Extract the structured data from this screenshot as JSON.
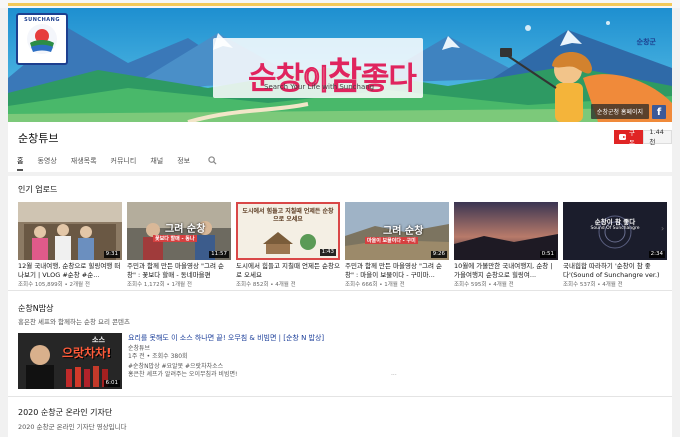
{
  "banner": {
    "logo_text": "SUNCHANG",
    "title_part1": "순창",
    "title_part2": "이",
    "title_part3": "참",
    "title_part4": "좋다",
    "subtitle": "Search Your Life with Sunchang",
    "brand": "순창군",
    "link_label": "순창군청 홈페이지",
    "fb_label": "f"
  },
  "channel": {
    "name": "순창튜브",
    "subscribe_label": "구독",
    "subscriber_count": "1.44천"
  },
  "tabs": [
    {
      "label": "홈",
      "active": true
    },
    {
      "label": "동영상"
    },
    {
      "label": "재생목록"
    },
    {
      "label": "커뮤니티"
    },
    {
      "label": "채널"
    },
    {
      "label": "정보"
    }
  ],
  "popular": {
    "title": "인기 업로드",
    "videos": [
      {
        "title": "12월 국내여행, 순창으로 힐링여행 떠나보기 | VLOG #순창 #순...",
        "meta": "조회수 105,899회 • 2개월 전",
        "duration": "9:31"
      },
      {
        "title": "주민과 함께 만든 마을영상 \"그려 순창\" : 꽃보다 할매 - 동네마을편",
        "meta": "조회수 1,172회 • 1개월 전",
        "duration": "11:57",
        "overlay": "그려 순창",
        "overlay_tag": "꽃보다 할매 - 동나"
      },
      {
        "title": "도시에서 힘들고 지칠때 언제든 순창으로 오세요",
        "meta": "조회수 852회 • 4개월 전",
        "duration": "1:43",
        "overlay": "도시에서 힘들고 지칠때 언제든 순창으로 오세요"
      },
      {
        "title": "주민과 함께 만든 마을영상 \"그려 순창\" : 마을이 보물이다 - 구미마...",
        "meta": "조회수 666회 • 1개월 전",
        "duration": "9:26",
        "overlay": "그려 순창",
        "overlay_tag": "마을이 보물이다 - 구미"
      },
      {
        "title": "10월에 가볼만한 국내여행지, 순창 | 가을여행지 순창으로 힐링여...",
        "meta": "조회수 595회 • 4개월 전",
        "duration": "0:51"
      },
      {
        "title": "국내힙합 따라하기 '순창이 참 좋다'(Sound of Sunchangre ver.)",
        "meta": "조회수 537회 • 4개월 전",
        "duration": "2:34",
        "overlay": "순창이 참 좋다",
        "overlay_tag": "Sound Of Sunchangre"
      }
    ]
  },
  "n_bang": {
    "title": "순창N밥상",
    "subtitle": "홍은찬 셰프와 함께하는 순창 요리 콘텐츠",
    "video_title": "요리를 못해도 이 소스 하나면 끝! 오무침 & 비빔면 | [순창 N 밥상]",
    "channel": "순창튜브",
    "meta": "1주 전 • 조회수 380회",
    "tags": "#순창N밥상 #요알못 #으랏차차소스",
    "description": "홍은찬 셰프가 알려주는 오이무침과 비빔면!",
    "duration": "6:01",
    "thumb_text": "으랏차차!",
    "thumb_tag": "소스",
    "dots": "..."
  },
  "reporters": {
    "title": "2020 순창군 온라인 기자단",
    "subtitle": "2020 순창군 온라인 기자단 영상입니다"
  },
  "colors": {
    "accent_red": "#e02525",
    "link_blue": "#1a3d99",
    "banner_sky": "#2fa6d8"
  }
}
